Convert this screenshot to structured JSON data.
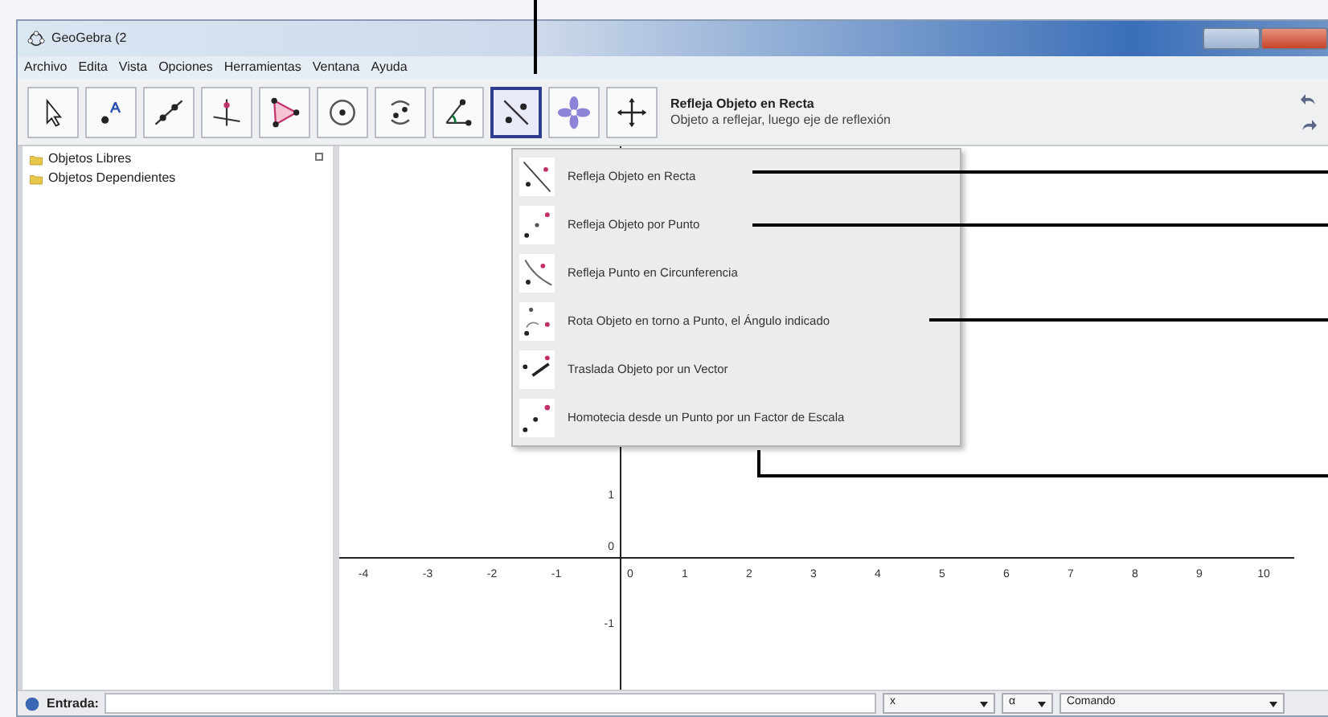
{
  "window": {
    "title": "GeoGebra (2"
  },
  "menu": [
    "Archivo",
    "Edita",
    "Vista",
    "Opciones",
    "Herramientas",
    "Ventana",
    "Ayuda"
  ],
  "toolbar": {
    "tools": [
      {
        "kind": "move",
        "selected": false
      },
      {
        "kind": "point",
        "selected": false
      },
      {
        "kind": "line",
        "selected": false
      },
      {
        "kind": "perpendicular",
        "selected": false
      },
      {
        "kind": "polygon",
        "selected": false
      },
      {
        "kind": "circle",
        "selected": false
      },
      {
        "kind": "conic",
        "selected": false
      },
      {
        "kind": "angle",
        "selected": false
      },
      {
        "kind": "reflect",
        "selected": true
      },
      {
        "kind": "slider",
        "selected": false
      },
      {
        "kind": "pan",
        "selected": false
      }
    ],
    "info": {
      "title": "Refleja Objeto en Recta",
      "hint": "Objeto a reflejar, luego eje de reflexión"
    }
  },
  "algebra_view": {
    "items": [
      "Objetos Libres",
      "Objetos Dependientes"
    ]
  },
  "tool_menu": {
    "items": [
      {
        "kind": "reflect-line",
        "label": "Refleja Objeto en Recta"
      },
      {
        "kind": "reflect-point",
        "label": "Refleja Objeto por Punto"
      },
      {
        "kind": "reflect-circle",
        "label": "Refleja Punto en Circunferencia"
      },
      {
        "kind": "rotate",
        "label": "Rota Objeto en torno a Punto, el Ángulo indicado"
      },
      {
        "kind": "translate",
        "label": "Traslada Objeto por un Vector"
      },
      {
        "kind": "dilate",
        "label": "Homotecia desde un Punto por un Factor de Escala"
      }
    ]
  },
  "graphics": {
    "x_labels": [
      "-4",
      "-3",
      "-2",
      "-1",
      "0",
      "1",
      "2",
      "3",
      "4",
      "5",
      "6",
      "7",
      "8",
      "9",
      "10"
    ],
    "y_labels": [
      "1",
      "0",
      "-1"
    ]
  },
  "input_bar": {
    "label": "Entrada:",
    "dropdowns": [
      "x",
      "α",
      "Comando"
    ]
  }
}
